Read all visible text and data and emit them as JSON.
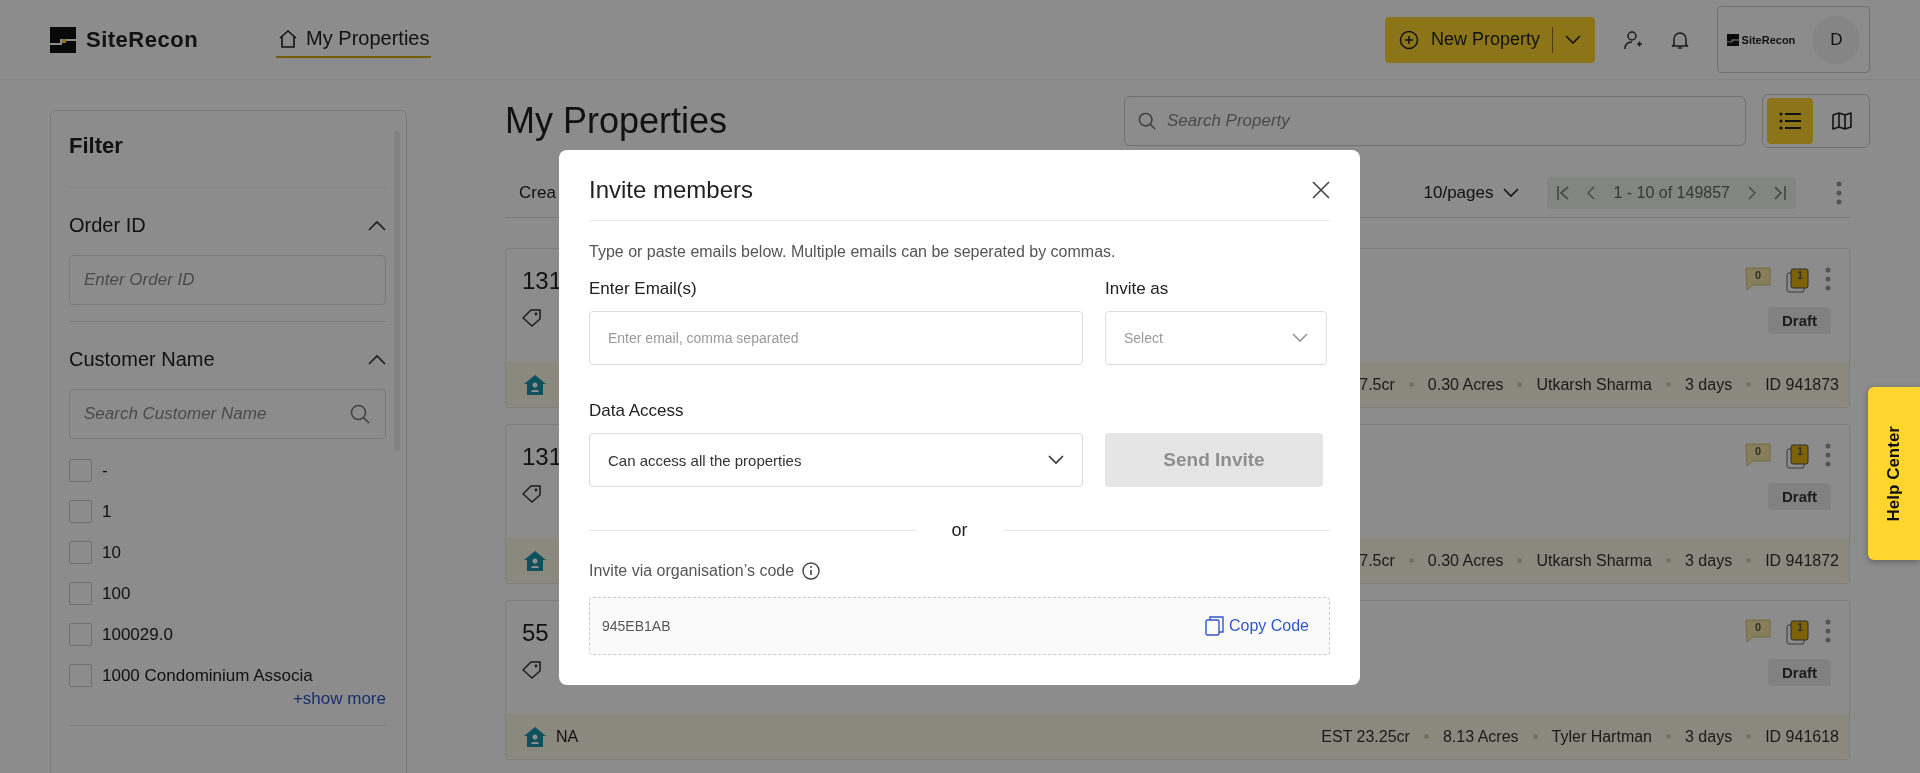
{
  "header": {
    "logo": "SiteRecon",
    "nav": [
      {
        "label": "My Properties",
        "selected": true
      }
    ],
    "new_property_button": "New Property",
    "org_logo": "SiteRecon",
    "avatar": "D"
  },
  "filter": {
    "title": "Filter",
    "sections": [
      {
        "kind": "input",
        "title": "Order ID",
        "expanded": true,
        "placeholder": "Enter Order ID"
      },
      {
        "kind": "checklist",
        "title": "Customer Name",
        "expanded": true,
        "placeholder": "Search Customer Name",
        "options": [
          {
            "label": "-",
            "checked": false
          },
          {
            "label": "1",
            "checked": false
          },
          {
            "label": "10",
            "checked": false
          },
          {
            "label": "100",
            "checked": false
          },
          {
            "label": "100029.0",
            "checked": false
          },
          {
            "label": "1000 Condominium Associa",
            "checked": false
          }
        ],
        "show_more": "+show more"
      }
    ]
  },
  "main": {
    "title": "My Properties",
    "search": {
      "placeholder": "Search Property"
    },
    "views": [
      {
        "kind": "list",
        "selected": true
      },
      {
        "kind": "map",
        "selected": false
      }
    ],
    "sort_label": "Crea",
    "page_size": "10/pages",
    "range": "1 - 10 of 149857",
    "cards": [
      {
        "title": "131",
        "comments": "0",
        "layers": "1",
        "status": "Draft",
        "details": [
          "7.5cr",
          "0.30 Acres",
          "Utkarsh Sharma",
          "3 days",
          "ID 941873"
        ]
      },
      {
        "title": "131",
        "comments": "0",
        "layers": "1",
        "status": "Draft",
        "details": [
          "7.5cr",
          "0.30 Acres",
          "Utkarsh Sharma",
          "3 days",
          "ID 941872"
        ]
      },
      {
        "title": "55",
        "comments": "0",
        "layers": "1",
        "status": "Draft",
        "label": "NA",
        "details": [
          "EST 23.25cr",
          "8.13 Acres",
          "Tyler Hartman",
          "3 days",
          "ID 941618"
        ]
      }
    ]
  },
  "help_center": "Help Center",
  "modal": {
    "title": "Invite members",
    "description": "Type or paste emails below. Multiple emails can be seperated by commas.",
    "email": {
      "label": "Enter Email(s)",
      "placeholder": "Enter email, comma separated"
    },
    "invite_as": {
      "label": "Invite as",
      "placeholder": "Select"
    },
    "data_access": {
      "label": "Data Access",
      "value": "Can access all the properties"
    },
    "send_button": {
      "label": "Send Invite",
      "disabled": true
    },
    "divider_text": "or",
    "code_label": "Invite via organisation’s code",
    "code": "945EB1AB",
    "copy_button": "Copy Code"
  }
}
